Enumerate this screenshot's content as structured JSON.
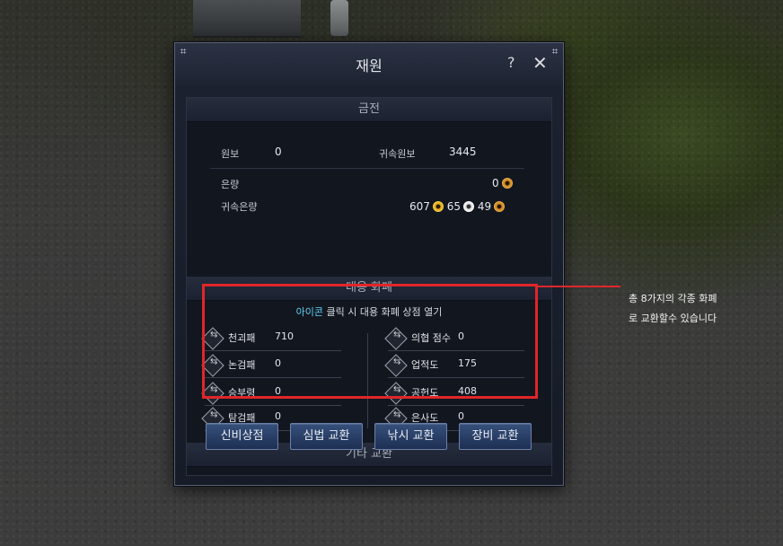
{
  "window": {
    "title": "재원",
    "help_label": "?",
    "close_label": "✕"
  },
  "money": {
    "header": "금전",
    "wonbo_label": "원보",
    "wonbo_value": "0",
    "bound_wonbo_label": "귀속원보",
    "bound_wonbo_value": "3445",
    "silver_label": "은량",
    "silver_value": "0",
    "bound_silver_label": "귀속은량",
    "bound_silver_gold": "607",
    "bound_silver_silver": "65",
    "bound_silver_copper": "49"
  },
  "alt_currency": {
    "header": "대용 화폐",
    "info_highlight": "아이콘",
    "info_rest": " 클릭 시 대용 화폐 상점 열기",
    "left": [
      {
        "name": "천괴패",
        "value": "710"
      },
      {
        "name": "논검패",
        "value": "0"
      },
      {
        "name": "승부령",
        "value": "0"
      },
      {
        "name": "탐검패",
        "value": "0"
      }
    ],
    "right": [
      {
        "name": "의협 점수",
        "value": "0"
      },
      {
        "name": "업적도",
        "value": "175"
      },
      {
        "name": "공헌도",
        "value": "408"
      },
      {
        "name": "은사도",
        "value": "0"
      }
    ]
  },
  "other_exchange": {
    "header": "기타 교환",
    "buttons": [
      "신비상점",
      "심법 교환",
      "낚시 교환",
      "장비 교환"
    ]
  },
  "annotation": {
    "line1": "총 8가지의 각종 화폐",
    "line2": "로 교환할수 있습니다"
  },
  "colors": {
    "highlight": "#5fd4f5",
    "annotation_red": "#e0262a",
    "gold_coin": "#e9b320",
    "silver_coin": "#e8e8e8",
    "copper_coin": "#d2902a"
  }
}
